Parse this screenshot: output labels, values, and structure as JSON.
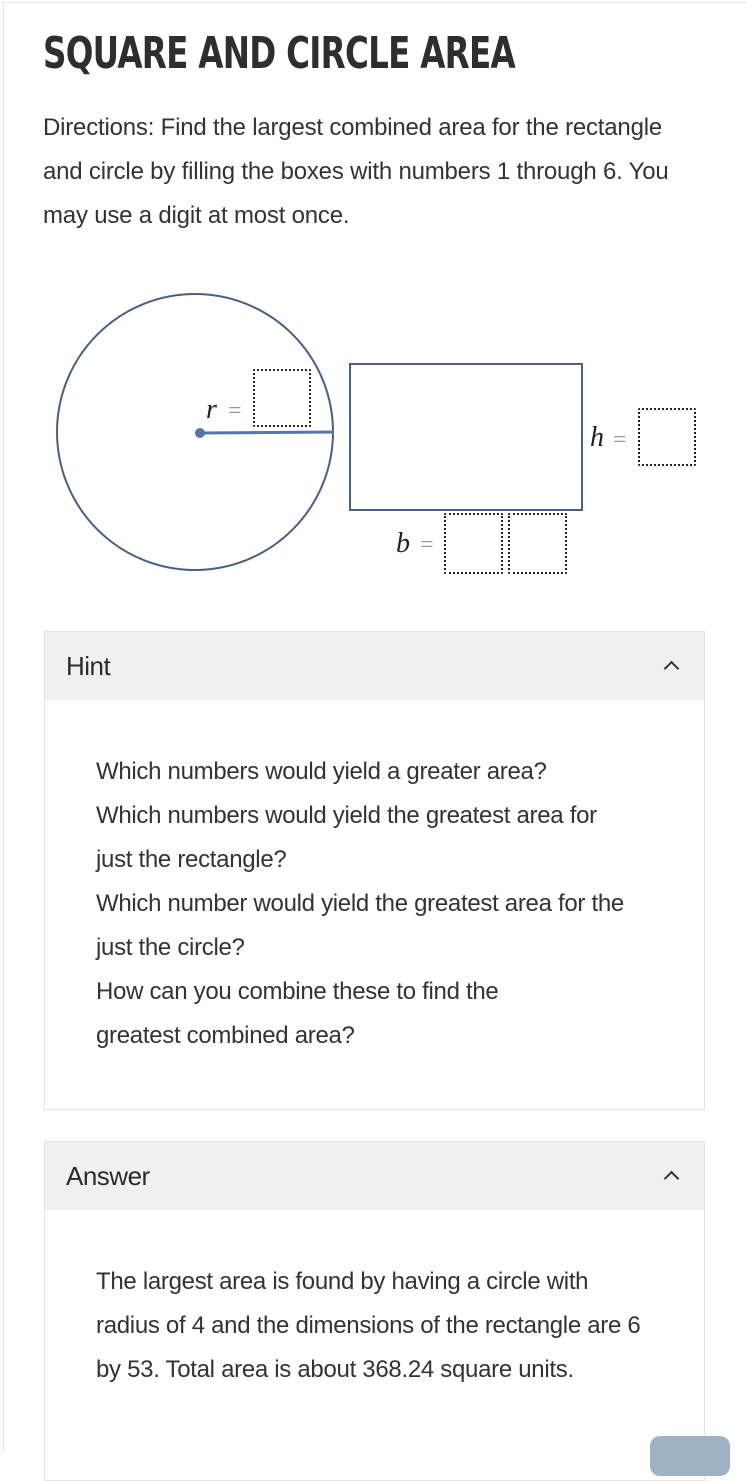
{
  "page": {
    "title": "SQUARE AND CIRCLE AREA",
    "directions": "Directions: Find the largest combined area for the rectangle and circle by filling the boxes with numbers 1 through 6. You may use a digit at most once."
  },
  "figure": {
    "stroke_color": "#4a6080",
    "radius_line_color": "#5577a8",
    "circle": {
      "label": "r",
      "equals": "=",
      "boxes": [
        ""
      ]
    },
    "rectangle": {
      "height_label": "h",
      "height_equals": "=",
      "height_boxes": [
        ""
      ],
      "base_label": "b",
      "base_equals": "=",
      "base_boxes": [
        "",
        ""
      ]
    }
  },
  "hint": {
    "title": "Hint",
    "expanded": true,
    "toggle_icon": "chevron-up-icon",
    "lines": [
      "Which numbers would yield a greater area?",
      "Which numbers would yield the greatest area for just the rectangle?",
      "Which number would yield the greatest area for the just the circle?",
      "How can you combine these to find the greatest combined area?"
    ]
  },
  "answer": {
    "title": "Answer",
    "expanded": true,
    "toggle_icon": "chevron-up-icon",
    "text": "The largest area is found by having a circle with radius of 4 and the dimensions of the rectangle are 6 by 53. Total area is about 368.24 square units."
  }
}
